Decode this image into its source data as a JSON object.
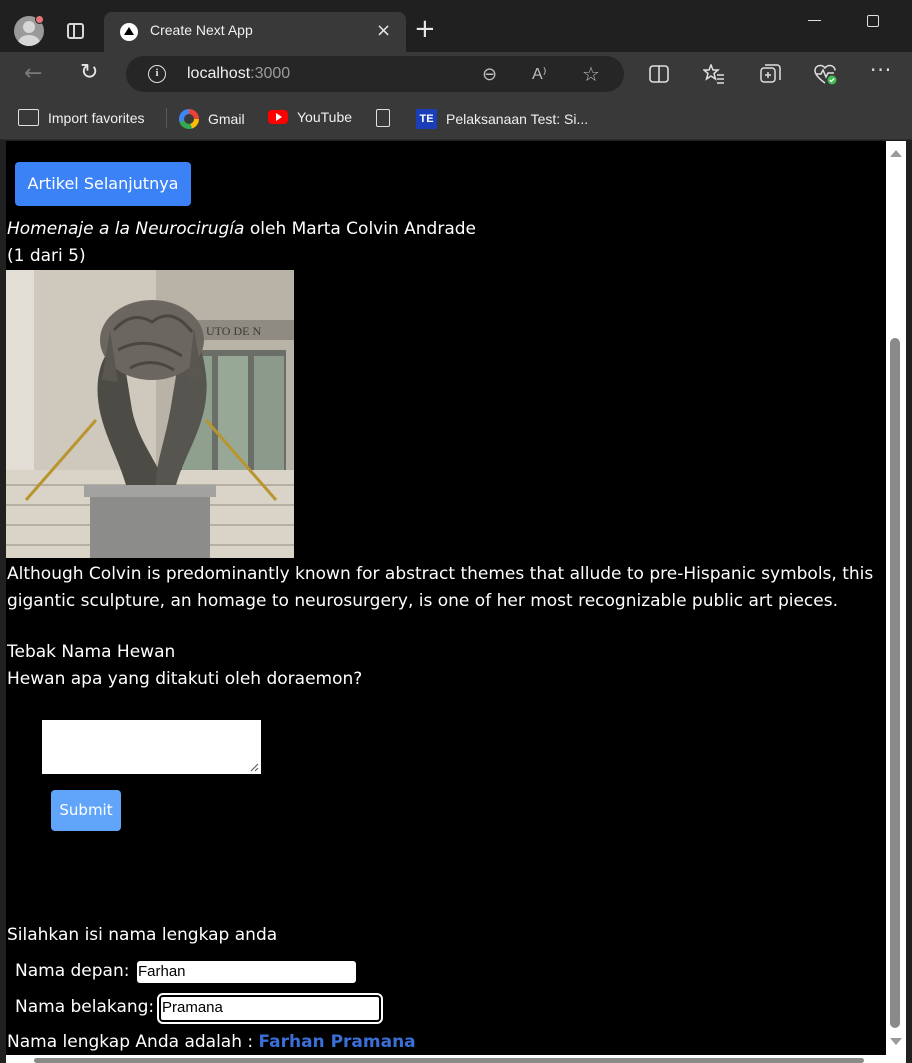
{
  "browser": {
    "tab": {
      "title": "Create Next App"
    },
    "address": {
      "host": "localhost",
      "port": ":3000"
    },
    "bookmarks": [
      {
        "label": "Import favorites",
        "icon": "import-icon"
      },
      {
        "label": "Gmail",
        "icon": "google-icon"
      },
      {
        "label": "YouTube",
        "icon": "youtube-icon"
      },
      {
        "label": "",
        "icon": "document-icon"
      },
      {
        "label": "Pelaksanaan Test: Si...",
        "icon": "te-icon"
      }
    ],
    "icons": {
      "tab_close": "×",
      "new_tab": "+",
      "back": "←",
      "refresh": "↻",
      "info": "i",
      "zoom": "⊖",
      "read_aloud": "A⁾",
      "favorite": "☆",
      "more": "···",
      "te_badge": "TE"
    }
  },
  "page": {
    "next_button": "Artikel Selanjutnya",
    "artwork": {
      "title": "Homenaje a la Neurocirugía",
      "by": " oleh Marta Colvin Andrade",
      "counter": "(1 dari 5)",
      "description": "Although Colvin is predominantly known for abstract themes that allude to pre-Hispanic symbols, this gigantic sculpture, an homage to neurosurgery, is one of her most recognizable public art pieces."
    },
    "quiz": {
      "title": "Tebak Nama Hewan",
      "question": "Hewan apa yang ditakuti oleh doraemon?",
      "answer": "",
      "submit": "Submit"
    },
    "name_form": {
      "prompt": "Silahkan isi nama lengkap anda",
      "first_label": "Nama depan:",
      "first_value": "Farhan",
      "last_label": "Nama belakang:",
      "last_value": "Pramana",
      "result_label": "Nama lengkap Anda adalah : ",
      "result_value": "Farhan Pramana"
    }
  },
  "colors": {
    "accent_button": "#3b82f6",
    "submit_button": "#60a5fa",
    "result_name": "#3b6fd8"
  }
}
